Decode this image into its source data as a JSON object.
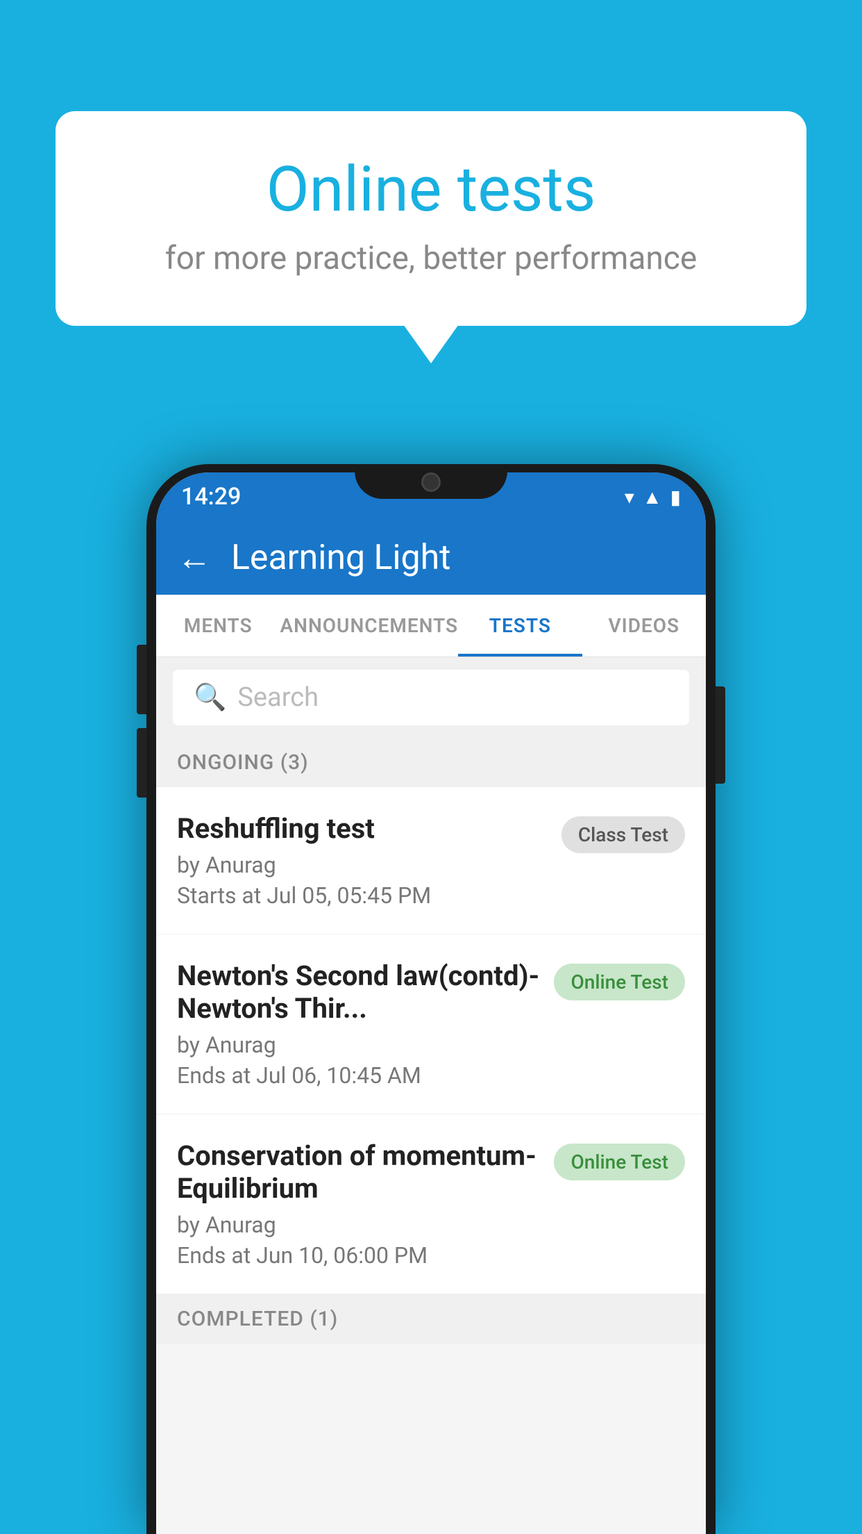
{
  "background_color": "#19b0e0",
  "bubble": {
    "title": "Online tests",
    "subtitle": "for more practice, better performance"
  },
  "phone": {
    "status_bar": {
      "time": "14:29",
      "icons": [
        "wifi",
        "signal",
        "battery"
      ]
    },
    "app_bar": {
      "title": "Learning Light",
      "back_label": "←"
    },
    "tabs": [
      {
        "label": "MENTS",
        "active": false
      },
      {
        "label": "ANNOUNCEMENTS",
        "active": false
      },
      {
        "label": "TESTS",
        "active": true
      },
      {
        "label": "VIDEOS",
        "active": false
      }
    ],
    "search": {
      "placeholder": "Search"
    },
    "ongoing_section": {
      "label": "ONGOING (3)"
    },
    "tests": [
      {
        "name": "Reshuffling test",
        "by": "by Anurag",
        "time_label": "Starts at",
        "time": "Jul 05, 05:45 PM",
        "badge": "Class Test",
        "badge_type": "class"
      },
      {
        "name": "Newton's Second law(contd)-Newton's Thir...",
        "by": "by Anurag",
        "time_label": "Ends at",
        "time": "Jul 06, 10:45 AM",
        "badge": "Online Test",
        "badge_type": "online"
      },
      {
        "name": "Conservation of momentum-Equilibrium",
        "by": "by Anurag",
        "time_label": "Ends at",
        "time": "Jun 10, 06:00 PM",
        "badge": "Online Test",
        "badge_type": "online"
      }
    ],
    "completed_section": {
      "label": "COMPLETED (1)"
    }
  }
}
